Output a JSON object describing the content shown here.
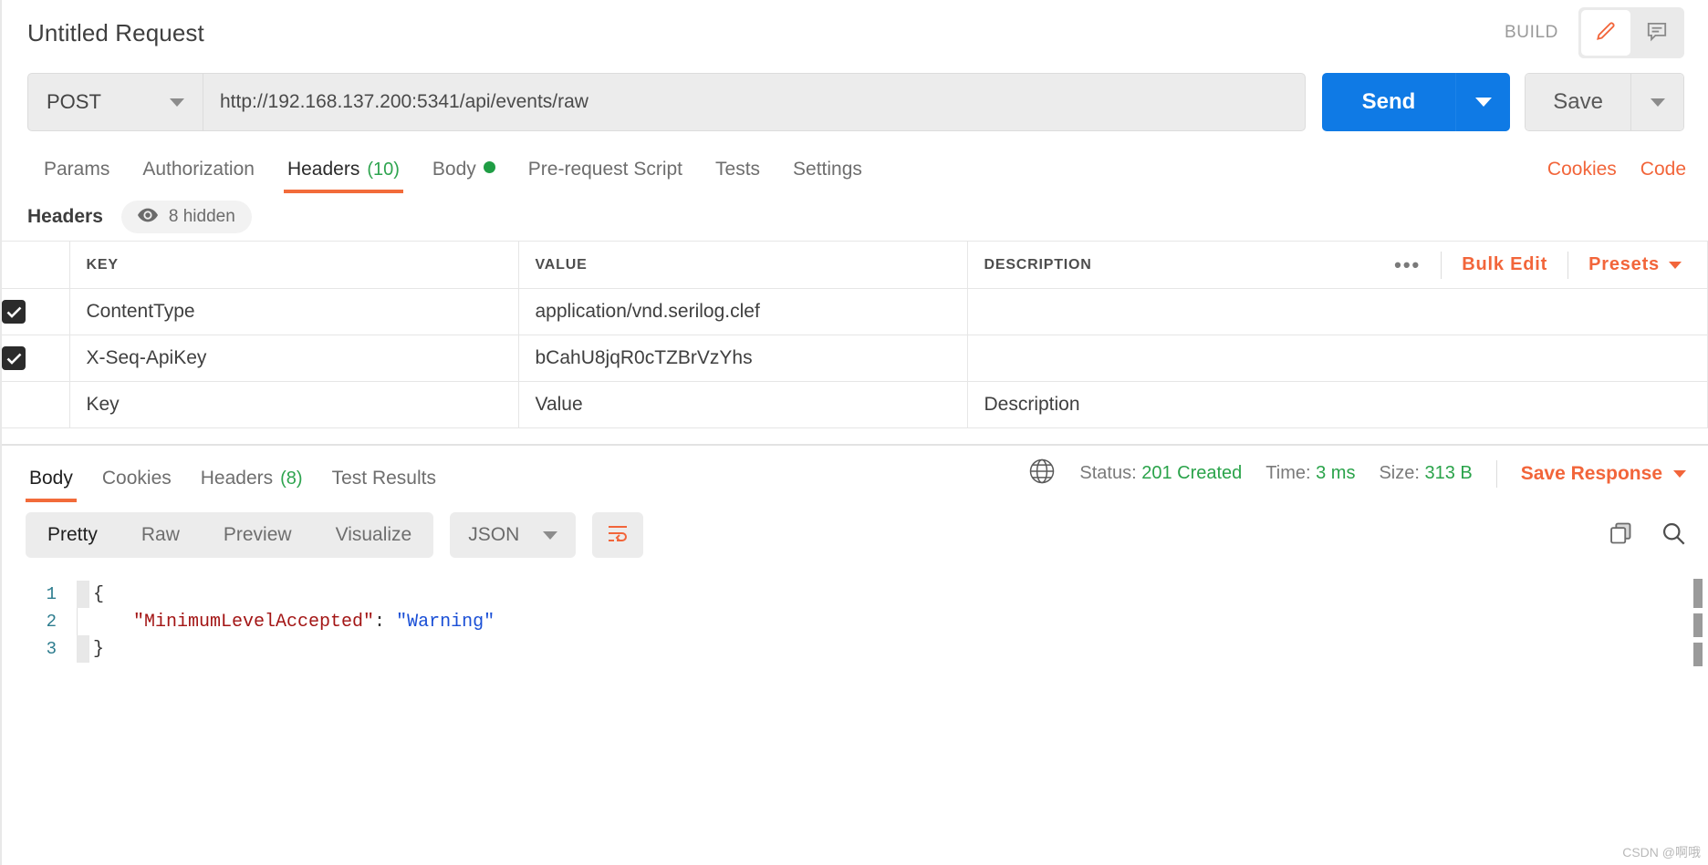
{
  "header": {
    "request_title": "Untitled Request",
    "build_label": "BUILD",
    "edit_icon": "pencil-icon",
    "comment_icon": "comment-icon"
  },
  "url_bar": {
    "method": "POST",
    "url": "http://192.168.137.200:5341/api/events/raw",
    "send_label": "Send",
    "save_label": "Save"
  },
  "request_tabs": {
    "items": [
      {
        "label": "Params",
        "count": "",
        "active": false
      },
      {
        "label": "Authorization",
        "count": "",
        "active": false
      },
      {
        "label": "Headers",
        "count": "(10)",
        "active": true
      },
      {
        "label": "Body",
        "count": "",
        "active": false,
        "dot": true
      },
      {
        "label": "Pre-request Script",
        "count": "",
        "active": false
      },
      {
        "label": "Tests",
        "count": "",
        "active": false
      },
      {
        "label": "Settings",
        "count": "",
        "active": false
      }
    ],
    "cookies_link": "Cookies",
    "code_link": "Code"
  },
  "headers_section": {
    "title": "Headers",
    "hidden_label": "8 hidden",
    "eye_icon": "eye-icon",
    "columns": {
      "key": "KEY",
      "value": "VALUE",
      "description": "DESCRIPTION"
    },
    "actions": {
      "more": "•••",
      "bulk_edit": "Bulk Edit",
      "presets": "Presets"
    },
    "rows": [
      {
        "checked": true,
        "key": "ContentType",
        "value": "application/vnd.serilog.clef",
        "description": ""
      },
      {
        "checked": true,
        "key": "X-Seq-ApiKey",
        "value": "bCahU8jqR0cTZBrVzYhs",
        "description": ""
      }
    ],
    "new_row_placeholders": {
      "key": "Key",
      "value": "Value",
      "description": "Description"
    }
  },
  "response": {
    "tabs": [
      {
        "label": "Body",
        "count": "",
        "active": true
      },
      {
        "label": "Cookies",
        "count": "",
        "active": false
      },
      {
        "label": "Headers",
        "count": "(8)",
        "active": false
      },
      {
        "label": "Test Results",
        "count": "",
        "active": false
      }
    ],
    "globe_icon": "globe-icon",
    "status_label": "Status:",
    "status_value": "201 Created",
    "time_label": "Time:",
    "time_value": "3 ms",
    "size_label": "Size:",
    "size_value": "313 B",
    "save_response": "Save Response",
    "view_modes": [
      "Pretty",
      "Raw",
      "Preview",
      "Visualize"
    ],
    "active_view_mode": "Pretty",
    "format": "JSON",
    "wrap_icon": "word-wrap-icon",
    "copy_icon": "copy-icon",
    "search_icon": "search-icon",
    "body_lines": [
      {
        "n": "1",
        "tokens": [
          {
            "t": "brace",
            "v": "{"
          }
        ]
      },
      {
        "n": "2",
        "tokens": [
          {
            "t": "indent",
            "v": ""
          },
          {
            "t": "key",
            "v": "\"MinimumLevelAccepted\""
          },
          {
            "t": "colon",
            "v": ":"
          },
          {
            "t": "space",
            "v": " "
          },
          {
            "t": "str",
            "v": "\"Warning\""
          }
        ]
      },
      {
        "n": "3",
        "tokens": [
          {
            "t": "brace",
            "v": "}"
          }
        ]
      }
    ]
  },
  "watermark": "CSDN @啊哦",
  "colors": {
    "accent_orange": "#f26b3a",
    "send_blue": "#0f7ae5",
    "status_green": "#2aa34a"
  }
}
